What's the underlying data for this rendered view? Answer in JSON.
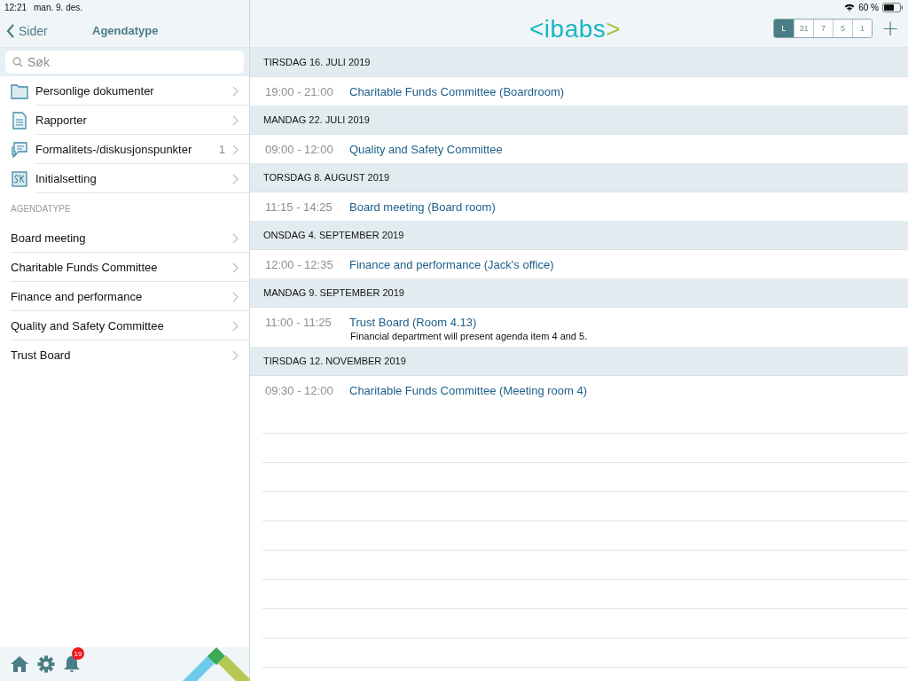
{
  "status_bar": {
    "time": "12:21",
    "date": "man. 9. des.",
    "battery": "60 %"
  },
  "sidebar": {
    "back": "Sider",
    "title": "Agendatype",
    "search": {
      "placeholder": "Søk"
    },
    "items": [
      {
        "kind": "folder",
        "label": "Personlige dokumenter"
      },
      {
        "kind": "report",
        "label": "Rapporter"
      },
      {
        "kind": "chat",
        "label": "Formalitets-/diskusjonspunkter",
        "count": "1"
      },
      {
        "kind": "initials",
        "label": "Initialsetting"
      }
    ],
    "section": "AGENDATYPE",
    "agenda_types": [
      "Board meeting",
      "Charitable Funds Committee",
      "Finance and performance",
      "Quality and Safety Committee",
      "Trust Board"
    ],
    "toolbar": {
      "notifications": "19"
    }
  },
  "header": {
    "logo": {
      "left": "<",
      "word": "ibabs",
      "right": ">"
    },
    "views": [
      {
        "label": "L",
        "selected": true
      },
      {
        "label": "31",
        "selected": false
      },
      {
        "label": "7",
        "selected": false
      },
      {
        "label": "5",
        "selected": false
      },
      {
        "label": "1",
        "selected": false
      }
    ],
    "add": "+"
  },
  "days": [
    {
      "date": "TIRSDAG 16. JULI 2019",
      "events": [
        {
          "time": "19:00 - 21:00",
          "title": "Charitable Funds Committee (Boardroom)"
        }
      ]
    },
    {
      "date": "MANDAG 22. JULI 2019",
      "events": [
        {
          "time": "09:00 - 12:00",
          "title": "Quality and Safety Committee"
        }
      ]
    },
    {
      "date": "TORSDAG 8. AUGUST 2019",
      "events": [
        {
          "time": "11:15 - 14:25",
          "title": "Board meeting (Board room)"
        }
      ]
    },
    {
      "date": "ONSDAG 4. SEPTEMBER 2019",
      "events": [
        {
          "time": "12:00 - 12:35",
          "title": "Finance and performance (Jack's office)"
        }
      ]
    },
    {
      "date": "MANDAG 9. SEPTEMBER 2019",
      "events": [
        {
          "time": "11:00 - 11:25",
          "title": "Trust Board (Room 4.13)",
          "note": "Financial department will present agenda item 4 and 5."
        }
      ]
    },
    {
      "date": "TIRSDAG 12. NOVEMBER 2019",
      "events": [
        {
          "time": "09:30 - 12:00",
          "title": "Charitable Funds Committee (Meeting room 4)"
        }
      ]
    }
  ]
}
